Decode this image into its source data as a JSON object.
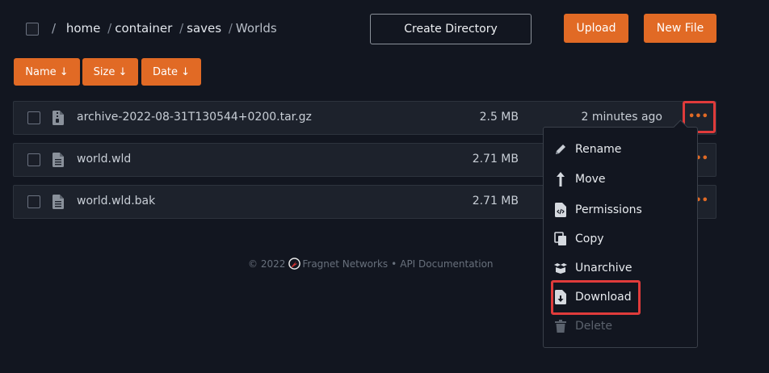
{
  "breadcrumb": {
    "leading_sep": "/",
    "items": [
      "home",
      "container",
      "saves"
    ],
    "current": "Worlds"
  },
  "toolbar": {
    "create_directory": "Create Directory",
    "upload": "Upload",
    "new_file": "New File"
  },
  "sort": {
    "name": "Name ↓",
    "size": "Size ↓",
    "date": "Date ↓"
  },
  "files": [
    {
      "name": "archive-2022-08-31T130544+0200.tar.gz",
      "size": "2.5 MB",
      "modified": "2 minutes ago",
      "icon": "archive-file-icon"
    },
    {
      "name": "world.wld",
      "size": "2.71 MB",
      "modified": "",
      "icon": "document-icon"
    },
    {
      "name": "world.wld.bak",
      "size": "2.71 MB",
      "modified": "",
      "icon": "document-icon"
    }
  ],
  "more_glyph": "•••",
  "context_menu": {
    "items": [
      {
        "label": "Rename",
        "icon": "pencil-icon"
      },
      {
        "label": "Move",
        "icon": "arrow-up-icon"
      },
      {
        "label": "Permissions",
        "icon": "file-code-icon"
      },
      {
        "label": "Copy",
        "icon": "copy-icon"
      },
      {
        "label": "Unarchive",
        "icon": "box-open-icon"
      },
      {
        "label": "Download",
        "icon": "file-download-icon"
      },
      {
        "label": "Delete",
        "icon": "trash-icon",
        "disabled": true
      }
    ]
  },
  "footer": {
    "copyright": "© 2022",
    "company": "Fragnet Networks",
    "dot": "•",
    "api_docs": "API Documentation"
  },
  "colors": {
    "background": "#121620",
    "accent": "#e16a25",
    "highlight": "#e03b3b",
    "row": "#1d222c"
  }
}
